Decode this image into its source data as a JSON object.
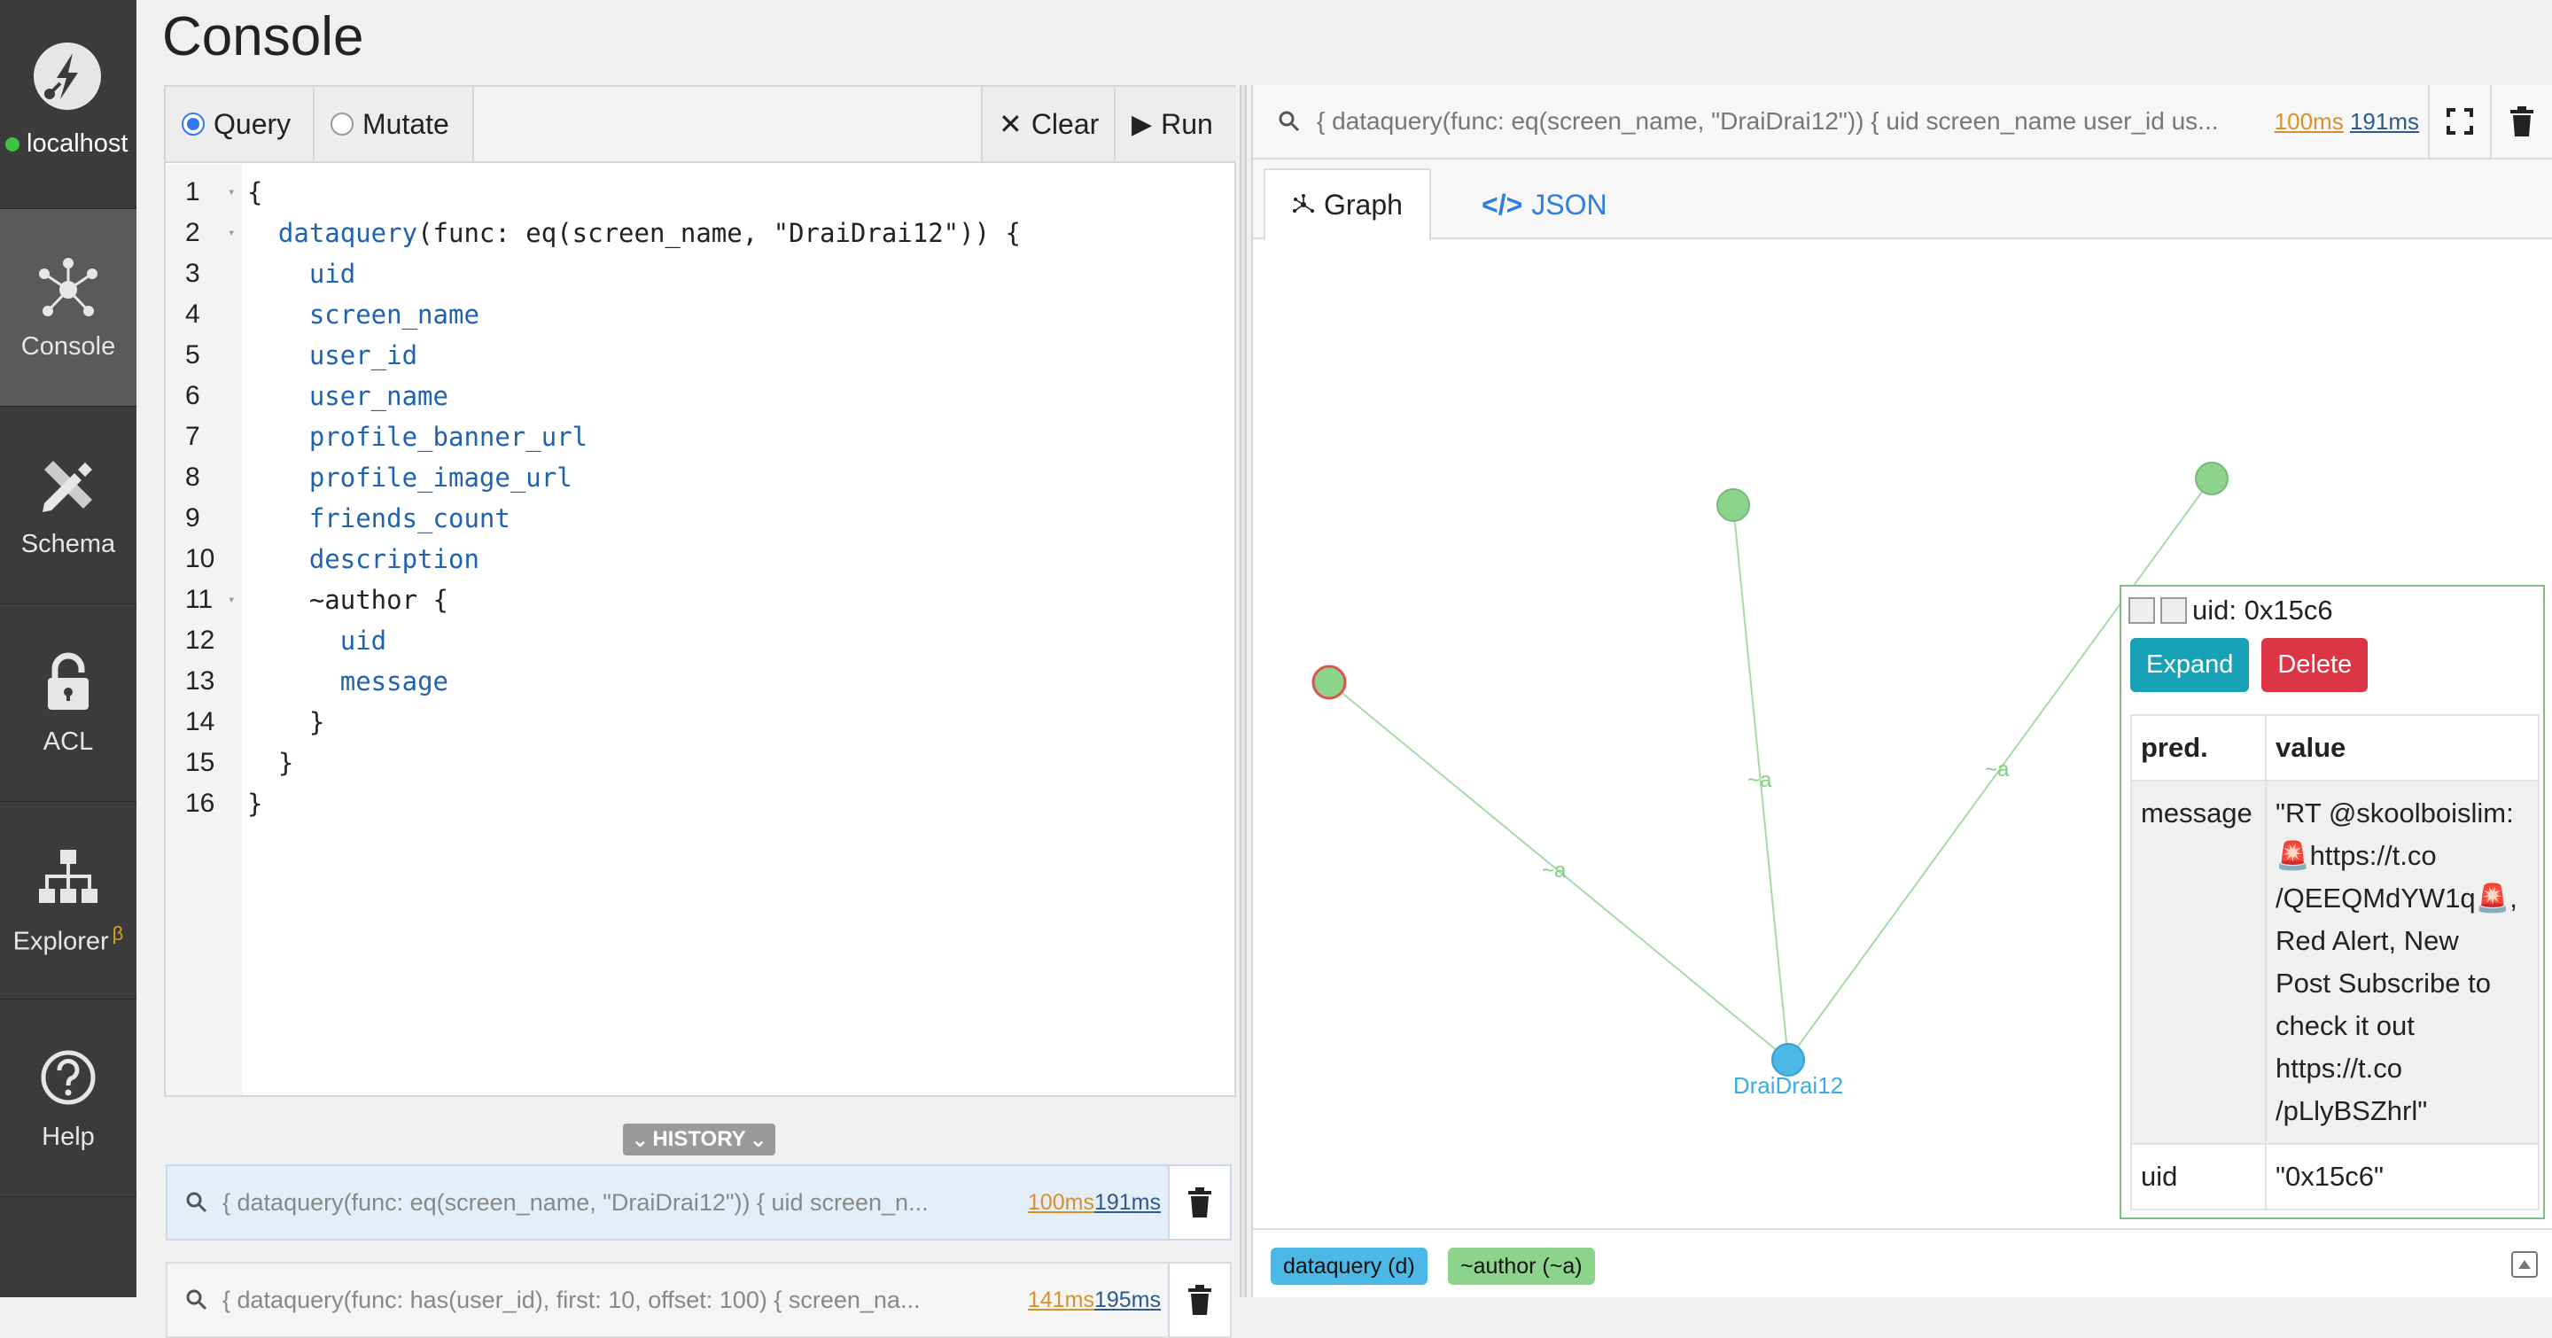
{
  "sidebar": {
    "server_name": "localhost",
    "items": [
      {
        "label": "Console",
        "icon": "network-icon"
      },
      {
        "label": "Schema",
        "icon": "pencil-ruler-icon"
      },
      {
        "label": "ACL",
        "icon": "lock-icon"
      },
      {
        "label": "Explorer",
        "icon": "hierarchy-icon",
        "badge": "β"
      },
      {
        "label": "Help",
        "icon": "question-icon"
      }
    ]
  },
  "page": {
    "title": "Console"
  },
  "editor": {
    "mode_query": "Query",
    "mode_mutate": "Mutate",
    "selected_mode": "Query",
    "clear_label": "Clear",
    "run_label": "Run",
    "lines": [
      {
        "n": "1",
        "text": "{",
        "fold": true
      },
      {
        "n": "2",
        "text": "  dataquery(func: eq(screen_name, \"DraiDrai12\")) {",
        "fold": true
      },
      {
        "n": "3",
        "text": "    uid"
      },
      {
        "n": "4",
        "text": "    screen_name"
      },
      {
        "n": "5",
        "text": "    user_id"
      },
      {
        "n": "6",
        "text": "    user_name"
      },
      {
        "n": "7",
        "text": "    profile_banner_url"
      },
      {
        "n": "8",
        "text": "    profile_image_url"
      },
      {
        "n": "9",
        "text": "    friends_count"
      },
      {
        "n": "10",
        "text": "    description"
      },
      {
        "n": "11",
        "text": "    ~author {",
        "fold": true
      },
      {
        "n": "12",
        "text": "      uid"
      },
      {
        "n": "13",
        "text": "      message"
      },
      {
        "n": "14",
        "text": "    }"
      },
      {
        "n": "15",
        "text": "  }"
      },
      {
        "n": "16",
        "text": "}"
      }
    ]
  },
  "history": {
    "label": "HISTORY",
    "entries": [
      {
        "query": "{ dataquery(func: eq(screen_name, \"DraiDrai12\")) { uid screen_n...",
        "t1": "100ms",
        "t2": "191ms"
      },
      {
        "query": "{ dataquery(func: has(user_id), first: 10, offset: 100) { screen_na...",
        "t1": "141ms",
        "t2": "195ms"
      }
    ]
  },
  "result": {
    "query": "{ dataquery(func: eq(screen_name, \"DraiDrai12\")) { uid screen_name user_id us...",
    "t1": "100ms",
    "t2": "191ms",
    "tab_graph": "Graph",
    "tab_json": "JSON",
    "graph": {
      "root_label": "DraiDrai12",
      "edge_label": "~a"
    },
    "legend": [
      {
        "label": "dataquery (d)",
        "color": "#4cb8e6"
      },
      {
        "label": "~author (~a)",
        "color": "#8cd48c"
      }
    ]
  },
  "node_panel": {
    "title": "uid: 0x15c6",
    "expand_label": "Expand",
    "delete_label": "Delete",
    "col_pred": "pred.",
    "col_value": "value",
    "rows": [
      {
        "pred": "message",
        "value_lines": [
          "\"RT @skoolboislim:",
          "🚨https://t.co",
          "/QEEQMdYW1q🚨,",
          "Red Alert, New",
          "Post Subscribe to",
          "check it out",
          "https://t.co",
          "/pLlyBSZhrl\""
        ]
      },
      {
        "pred": "uid",
        "value": "\"0x15c6\""
      }
    ]
  },
  "colors": {
    "accent": "#3478f6",
    "node_root": "#4cb8e6",
    "node_child": "#8cd48c",
    "expand": "#17a2b8",
    "delete": "#dc3545"
  }
}
